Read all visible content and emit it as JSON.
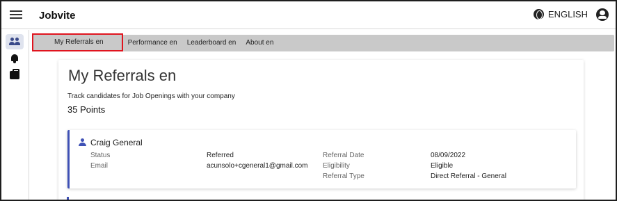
{
  "app": {
    "title": "Jobvite"
  },
  "header": {
    "language_label": "ENGLISH"
  },
  "tabs": [
    {
      "label": "My Referrals en"
    },
    {
      "label": "Performance en"
    },
    {
      "label": "Leaderboard en"
    },
    {
      "label": "About en"
    }
  ],
  "rail": {
    "items": [
      {
        "icon": "people-icon",
        "active": true
      },
      {
        "icon": "bell-icon",
        "active": false
      },
      {
        "icon": "briefcase-icon",
        "active": false
      }
    ]
  },
  "main": {
    "title": "My Referrals en",
    "subtitle": "Track candidates for Job Openings with your company",
    "points": "35 Points"
  },
  "referral": {
    "name": "Craig General",
    "status_label": "Status",
    "status_value": "Referred",
    "email_label": "Email",
    "email_value": "acunsolo+cgeneral1@gmail.com",
    "referral_date_label": "Referral Date",
    "referral_date_value": "08/09/2022",
    "eligibility_label": "Eligibility",
    "eligibility_value": "Eligible",
    "referral_type_label": "Referral Type",
    "referral_type_value": "Direct Referral - General"
  },
  "colors": {
    "accent": "#3f51b5",
    "highlight": "#e0141e",
    "tab_bar": "#c9c9c9"
  }
}
